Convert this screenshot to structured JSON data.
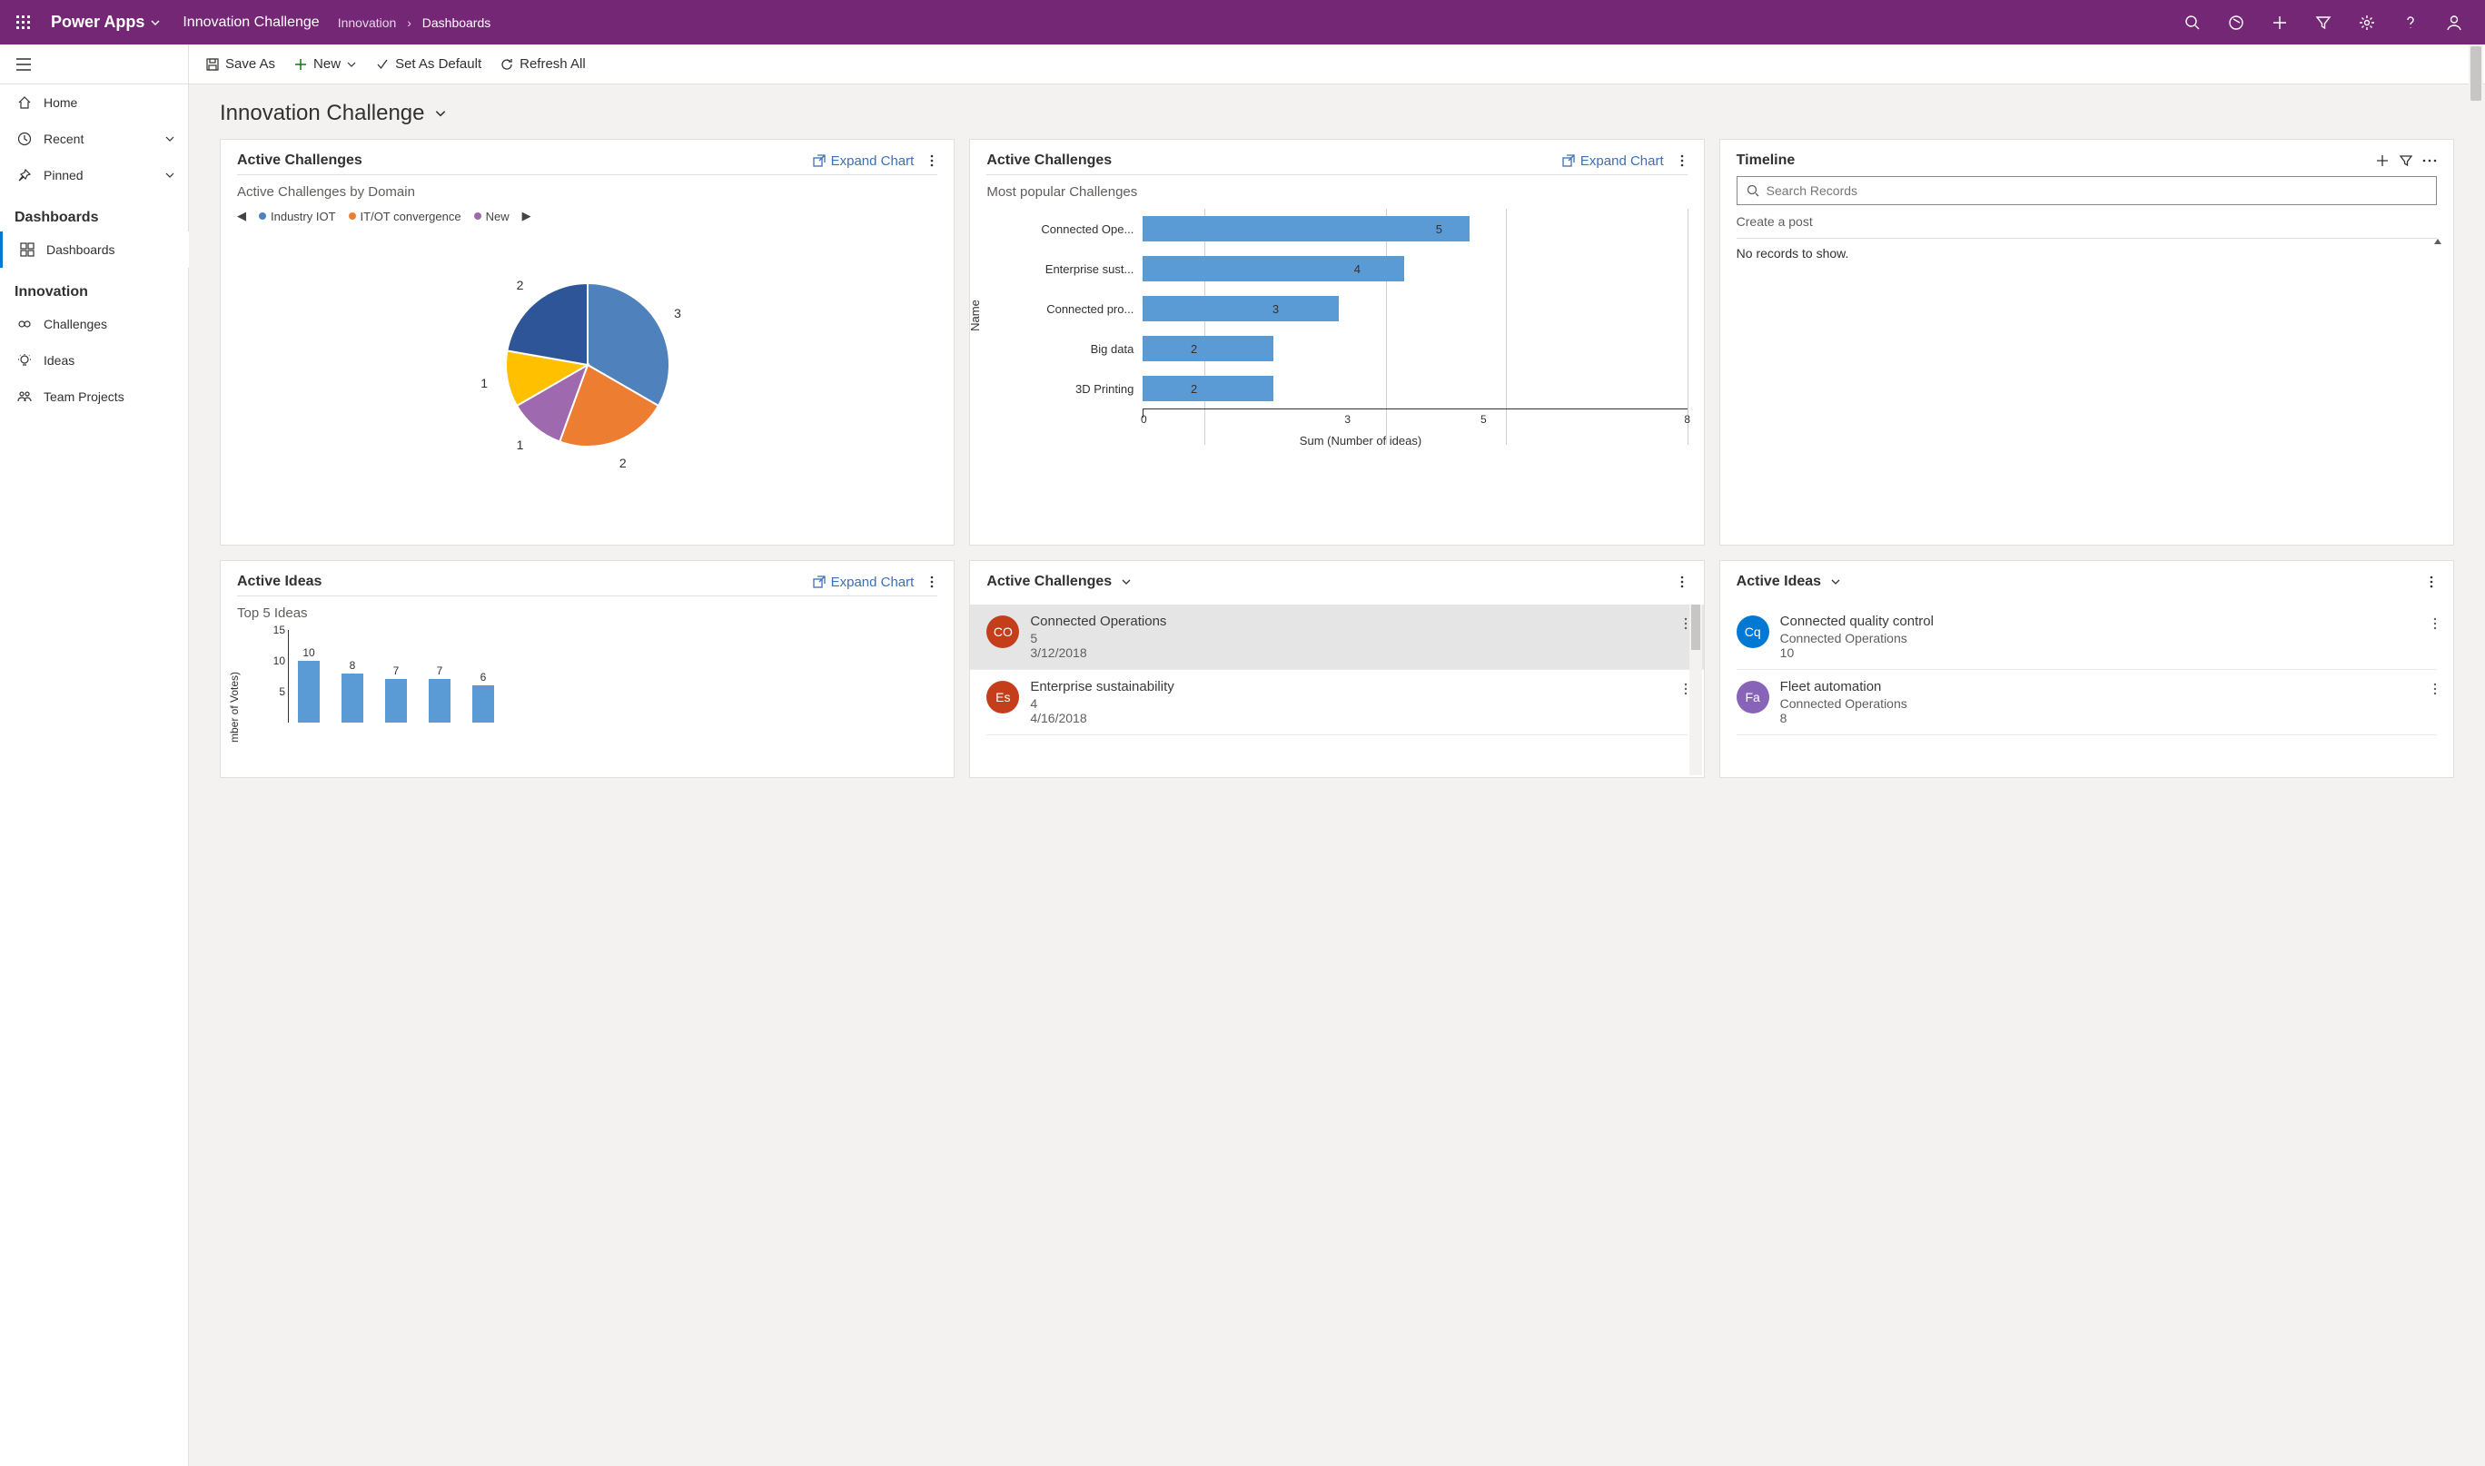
{
  "topbar": {
    "brand": "Power Apps",
    "app_title": "Innovation Challenge",
    "crumb_parent": "Innovation",
    "crumb_current": "Dashboards"
  },
  "sidebar": {
    "items_top": [
      {
        "label": "Home",
        "icon": "home"
      },
      {
        "label": "Recent",
        "icon": "clock",
        "chevron": true
      },
      {
        "label": "Pinned",
        "icon": "pin",
        "chevron": true
      }
    ],
    "section1_head": "Dashboards",
    "section1_items": [
      {
        "label": "Dashboards",
        "icon": "dashboard",
        "selected": true
      }
    ],
    "section2_head": "Innovation",
    "section2_items": [
      {
        "label": "Challenges",
        "icon": "challenge"
      },
      {
        "label": "Ideas",
        "icon": "idea"
      },
      {
        "label": "Team Projects",
        "icon": "team"
      }
    ]
  },
  "cmdbar": {
    "save_as": "Save As",
    "new": "New",
    "set_default": "Set As Default",
    "refresh": "Refresh All"
  },
  "page_title": "Innovation Challenge",
  "cards": {
    "c1": {
      "title": "Active Challenges",
      "expand": "Expand Chart",
      "sub": "Active Challenges by Domain",
      "legend": [
        "Industry IOT",
        "IT/OT convergence",
        "New"
      ]
    },
    "c2": {
      "title": "Active Challenges",
      "expand": "Expand Chart",
      "sub": "Most popular Challenges",
      "ylabel": "Name",
      "xlabel": "Sum (Number of ideas)"
    },
    "c3": {
      "title": "Timeline",
      "search_ph": "Search Records",
      "create": "Create a post",
      "empty": "No records to show."
    },
    "c4": {
      "title": "Active Ideas",
      "expand": "Expand Chart",
      "sub": "Top 5 Ideas",
      "ylabel": "mber of Votes)"
    },
    "c5": {
      "title": "Active Challenges",
      "items": [
        {
          "initials": "CO",
          "color": "#c43e1c",
          "l1": "Connected Operations",
          "l2a": "5",
          "l2b": "3/12/2018",
          "sel": true
        },
        {
          "initials": "Es",
          "color": "#c43e1c",
          "l1": "Enterprise sustainability",
          "l2a": "4",
          "l2b": "4/16/2018"
        }
      ]
    },
    "c6": {
      "title": "Active Ideas",
      "items": [
        {
          "initials": "Cq",
          "color": "#0078d4",
          "l1": "Connected quality control",
          "l2a": "Connected Operations",
          "l2b": "10"
        },
        {
          "initials": "Fa",
          "color": "#8764b8",
          "l1": "Fleet automation",
          "l2a": "Connected Operations",
          "l2b": "8"
        }
      ]
    }
  },
  "chart_data": {
    "pie": {
      "type": "pie",
      "title": "Active Challenges by Domain",
      "series": [
        {
          "name": "Industry IOT",
          "value": 3,
          "color": "#4f81bd"
        },
        {
          "name": "IT/OT convergence",
          "value": 2,
          "color": "#ed7d31"
        },
        {
          "name": "New",
          "value": 1,
          "color": "#9e69af"
        },
        {
          "name": "(slice 4)",
          "value": 1,
          "color": "#ffc000"
        },
        {
          "name": "(slice 5)",
          "value": 2,
          "color": "#2e5597"
        }
      ]
    },
    "hbar": {
      "type": "bar",
      "orientation": "horizontal",
      "title": "Most popular Challenges",
      "xlabel": "Sum (Number of ideas)",
      "ylabel": "Name",
      "xlim": [
        0,
        8
      ],
      "xticks": [
        0,
        3,
        5,
        8
      ],
      "categories": [
        "Connected Ope...",
        "Enterprise sust...",
        "Connected pro...",
        "Big data",
        "3D Printing"
      ],
      "values": [
        5,
        4,
        3,
        2,
        2
      ]
    },
    "vbar": {
      "type": "bar",
      "title": "Top 5 Ideas",
      "ylabel": "Sum (Number of Votes)",
      "ylim": [
        0,
        15
      ],
      "yticks": [
        5,
        10,
        15
      ],
      "values": [
        10,
        8,
        7,
        7,
        6
      ]
    }
  }
}
